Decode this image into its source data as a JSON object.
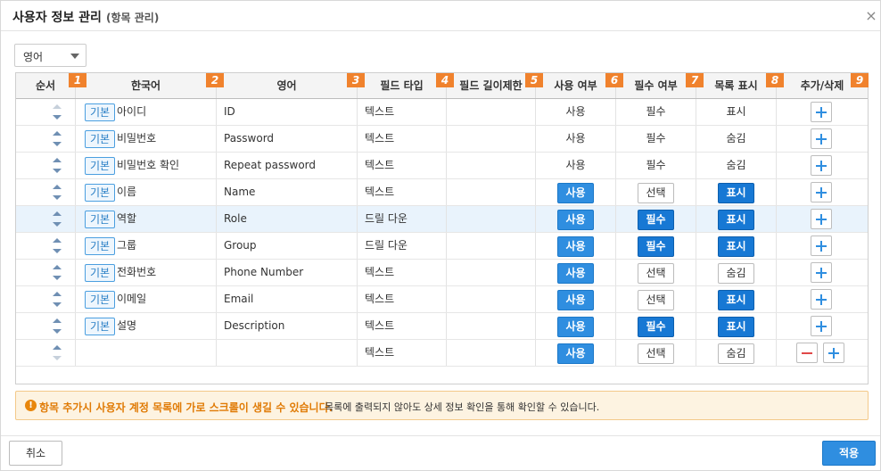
{
  "dialog": {
    "title": "사용자 정보 관리",
    "subtitle": "(항목 관리)",
    "close_icon": "×"
  },
  "language_select": {
    "value": "영어"
  },
  "table": {
    "headers": [
      {
        "label": "순서",
        "num": "1"
      },
      {
        "label": "한국어",
        "num": "2"
      },
      {
        "label": "영어",
        "num": "3"
      },
      {
        "label": "필드 타입",
        "num": "4"
      },
      {
        "label": "필드 길이제한",
        "num": "5"
      },
      {
        "label": "사용 여부",
        "num": "6"
      },
      {
        "label": "필수 여부",
        "num": "7"
      },
      {
        "label": "목록 표시",
        "num": "8"
      },
      {
        "label": "추가/삭제",
        "num": "9"
      }
    ],
    "rows": [
      {
        "basic": "기본",
        "ko": "아이디",
        "en": "ID",
        "type": "텍스트",
        "length": "",
        "use": "사용",
        "use_style": "text",
        "required": "필수",
        "req_style": "text",
        "list": "표시",
        "list_style": "text",
        "highlight": false
      },
      {
        "basic": "기본",
        "ko": "비밀번호",
        "en": "Password",
        "type": "텍스트",
        "length": "",
        "use": "사용",
        "use_style": "text",
        "required": "필수",
        "req_style": "text",
        "list": "숨김",
        "list_style": "text",
        "highlight": false
      },
      {
        "basic": "기본",
        "ko": "비밀번호 확인",
        "en": "Repeat password",
        "type": "텍스트",
        "length": "",
        "use": "사용",
        "use_style": "text",
        "required": "필수",
        "req_style": "text",
        "list": "숨김",
        "list_style": "text",
        "highlight": false
      },
      {
        "basic": "기본",
        "ko": "이름",
        "en": "Name",
        "type": "텍스트",
        "length": "",
        "use": "사용",
        "use_style": "blue",
        "required": "선택",
        "req_style": "white",
        "list": "표시",
        "list_style": "dark",
        "highlight": false
      },
      {
        "basic": "기본",
        "ko": "역할",
        "en": "Role",
        "type": "드릴 다운",
        "length": "",
        "use": "사용",
        "use_style": "blue",
        "required": "필수",
        "req_style": "dark",
        "list": "표시",
        "list_style": "dark",
        "highlight": true
      },
      {
        "basic": "기본",
        "ko": "그룹",
        "en": "Group",
        "type": "드릴 다운",
        "length": "",
        "use": "사용",
        "use_style": "blue",
        "required": "필수",
        "req_style": "dark",
        "list": "표시",
        "list_style": "dark",
        "highlight": false
      },
      {
        "basic": "기본",
        "ko": "전화번호",
        "en": "Phone Number",
        "type": "텍스트",
        "length": "",
        "use": "사용",
        "use_style": "blue",
        "required": "선택",
        "req_style": "white",
        "list": "숨김",
        "list_style": "white",
        "highlight": false
      },
      {
        "basic": "기본",
        "ko": "이메일",
        "en": "Email",
        "type": "텍스트",
        "length": "",
        "use": "사용",
        "use_style": "blue",
        "required": "선택",
        "req_style": "white",
        "list": "표시",
        "list_style": "dark",
        "highlight": false
      },
      {
        "basic": "기본",
        "ko": "설명",
        "en": "Description",
        "type": "텍스트",
        "length": "",
        "use": "사용",
        "use_style": "blue",
        "required": "필수",
        "req_style": "dark",
        "list": "표시",
        "list_style": "dark",
        "highlight": false
      },
      {
        "basic": "",
        "ko": "",
        "en": "",
        "type": "텍스트",
        "length": "",
        "use": "사용",
        "use_style": "blue",
        "required": "선택",
        "req_style": "white",
        "list": "숨김",
        "list_style": "white",
        "highlight": false,
        "deletable": true
      }
    ]
  },
  "notice": {
    "icon": "!",
    "strong": "항목 추가시 사용자 계정 목록에 가로 스크롤이 생길 수 있습니다.",
    "text": "목록에 출력되지 않아도 상세 정보 확인을 통해 확인할 수 있습니다."
  },
  "footer": {
    "cancel_label": "취소",
    "apply_label": "적용"
  },
  "colors": {
    "accent": "#2f8ee0",
    "accent_dark": "#1778d4",
    "badge": "#f0822d",
    "notice_bg": "#fdf3e1",
    "warning": "#e07b06"
  }
}
